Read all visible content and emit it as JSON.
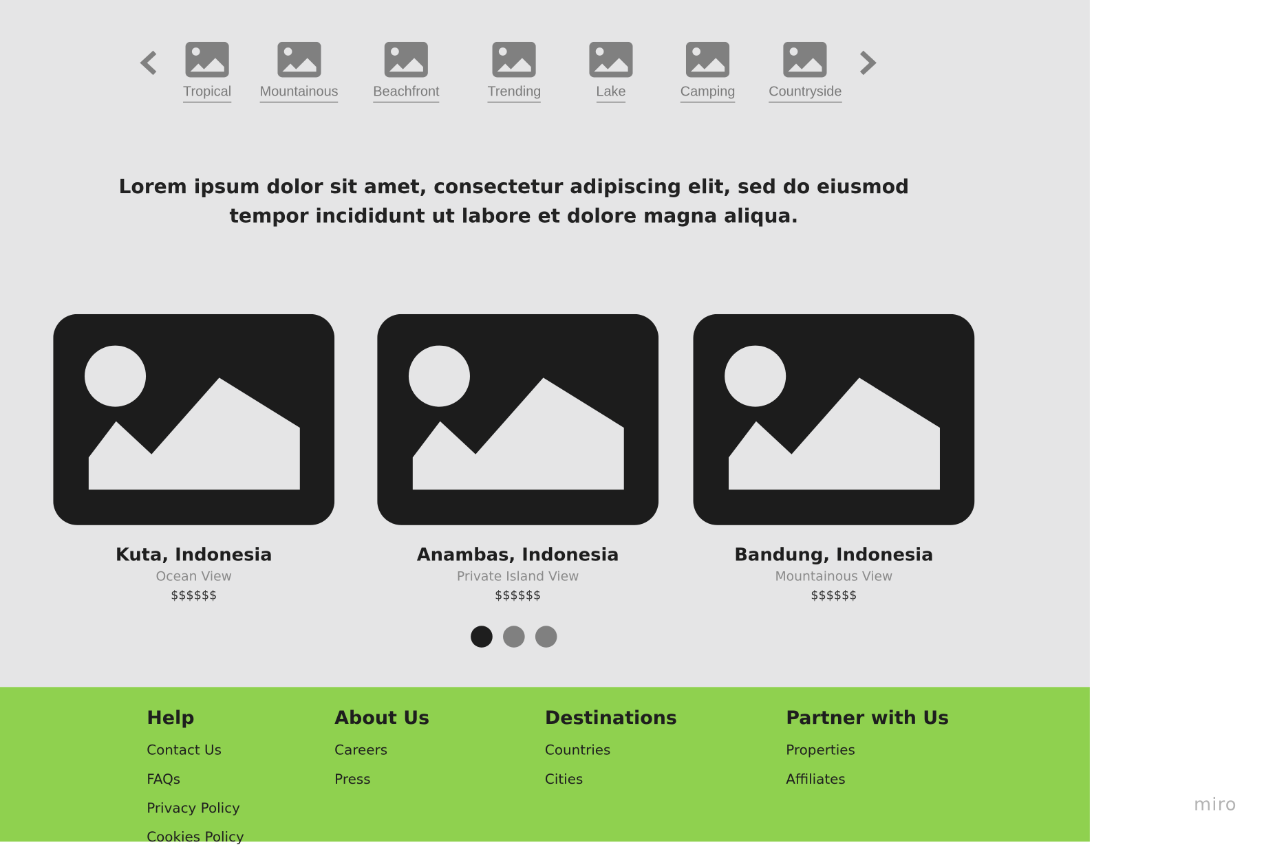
{
  "categories": [
    {
      "label": "Tropical"
    },
    {
      "label": "Mountainous"
    },
    {
      "label": "Beachfront"
    },
    {
      "label": "Trending"
    },
    {
      "label": "Lake"
    },
    {
      "label": "Camping"
    },
    {
      "label": "Countryside"
    }
  ],
  "headline": "Lorem ipsum dolor sit amet, consectetur adipiscing elit, sed do eiusmod tempor incididunt ut labore et dolore magna aliqua.",
  "listings": [
    {
      "title": "Kuta, Indonesia",
      "subtitle": "Ocean View",
      "price": "$$$$$$"
    },
    {
      "title": "Anambas, Indonesia",
      "subtitle": "Private Island View",
      "price": "$$$$$$"
    },
    {
      "title": "Bandung, Indonesia",
      "subtitle": "Mountainous View",
      "price": "$$$$$$"
    }
  ],
  "pagination": {
    "total": 3,
    "active_index": 0
  },
  "footer": {
    "columns": [
      {
        "heading": "Help",
        "links": [
          "Contact Us",
          "FAQs",
          "Privacy Policy",
          "Cookies Policy"
        ]
      },
      {
        "heading": "About Us",
        "links": [
          "Careers",
          "Press"
        ]
      },
      {
        "heading": "Destinations",
        "links": [
          "Countries",
          "Cities"
        ]
      },
      {
        "heading": "Partner with Us",
        "links": [
          "Properties",
          "Affiliates"
        ]
      }
    ]
  },
  "brand": "miro",
  "colors": {
    "canvas": "#e5e5e6",
    "footer": "#8fd14f",
    "placeholder_dark": "#1e1e1e",
    "icon_gray": "#808080",
    "dot_active": "#1e1e1e",
    "dot_inactive": "#808080"
  }
}
